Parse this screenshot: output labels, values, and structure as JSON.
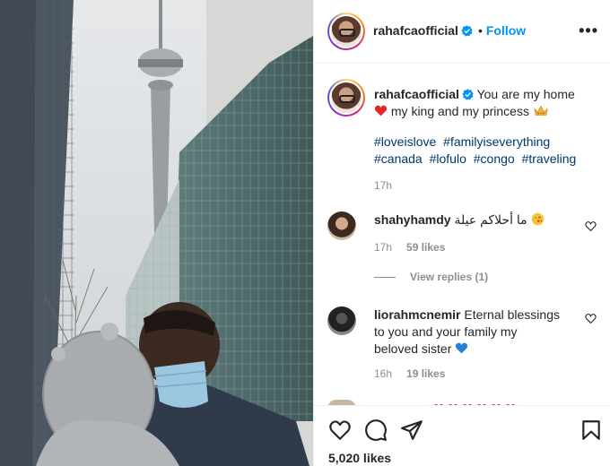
{
  "post": {
    "username": "rahafcaofficial",
    "follow_label": "Follow",
    "dot": "•",
    "more": "•••",
    "caption_text": "You are my home",
    "caption_text_2": "my king and my princess",
    "hashtags": [
      "#loveislove",
      "#familyiseverything",
      "#canada",
      "#lofulo",
      "#congo",
      "#traveling"
    ],
    "caption_time": "17h",
    "likes": "5,020 likes"
  },
  "comments": [
    {
      "username": "shahyhamdy",
      "text": "ما أحلاكم عيلة",
      "time": "17h",
      "likes": "59 likes",
      "view_replies": "View replies (1)"
    },
    {
      "username": "liorahmcnemir",
      "text": "Eternal blessings to you and your family my beloved sister",
      "time": "16h",
      "likes": "19 likes"
    }
  ],
  "colors": {
    "accent": "#0095f6",
    "hashtag": "#00376b",
    "muted": "#8e8e8e",
    "heart": "#ed4956"
  },
  "icons": {
    "verified": "verified-badge-icon",
    "like": "heart-icon",
    "comment": "comment-icon",
    "share": "paper-plane-icon",
    "save": "bookmark-icon"
  }
}
